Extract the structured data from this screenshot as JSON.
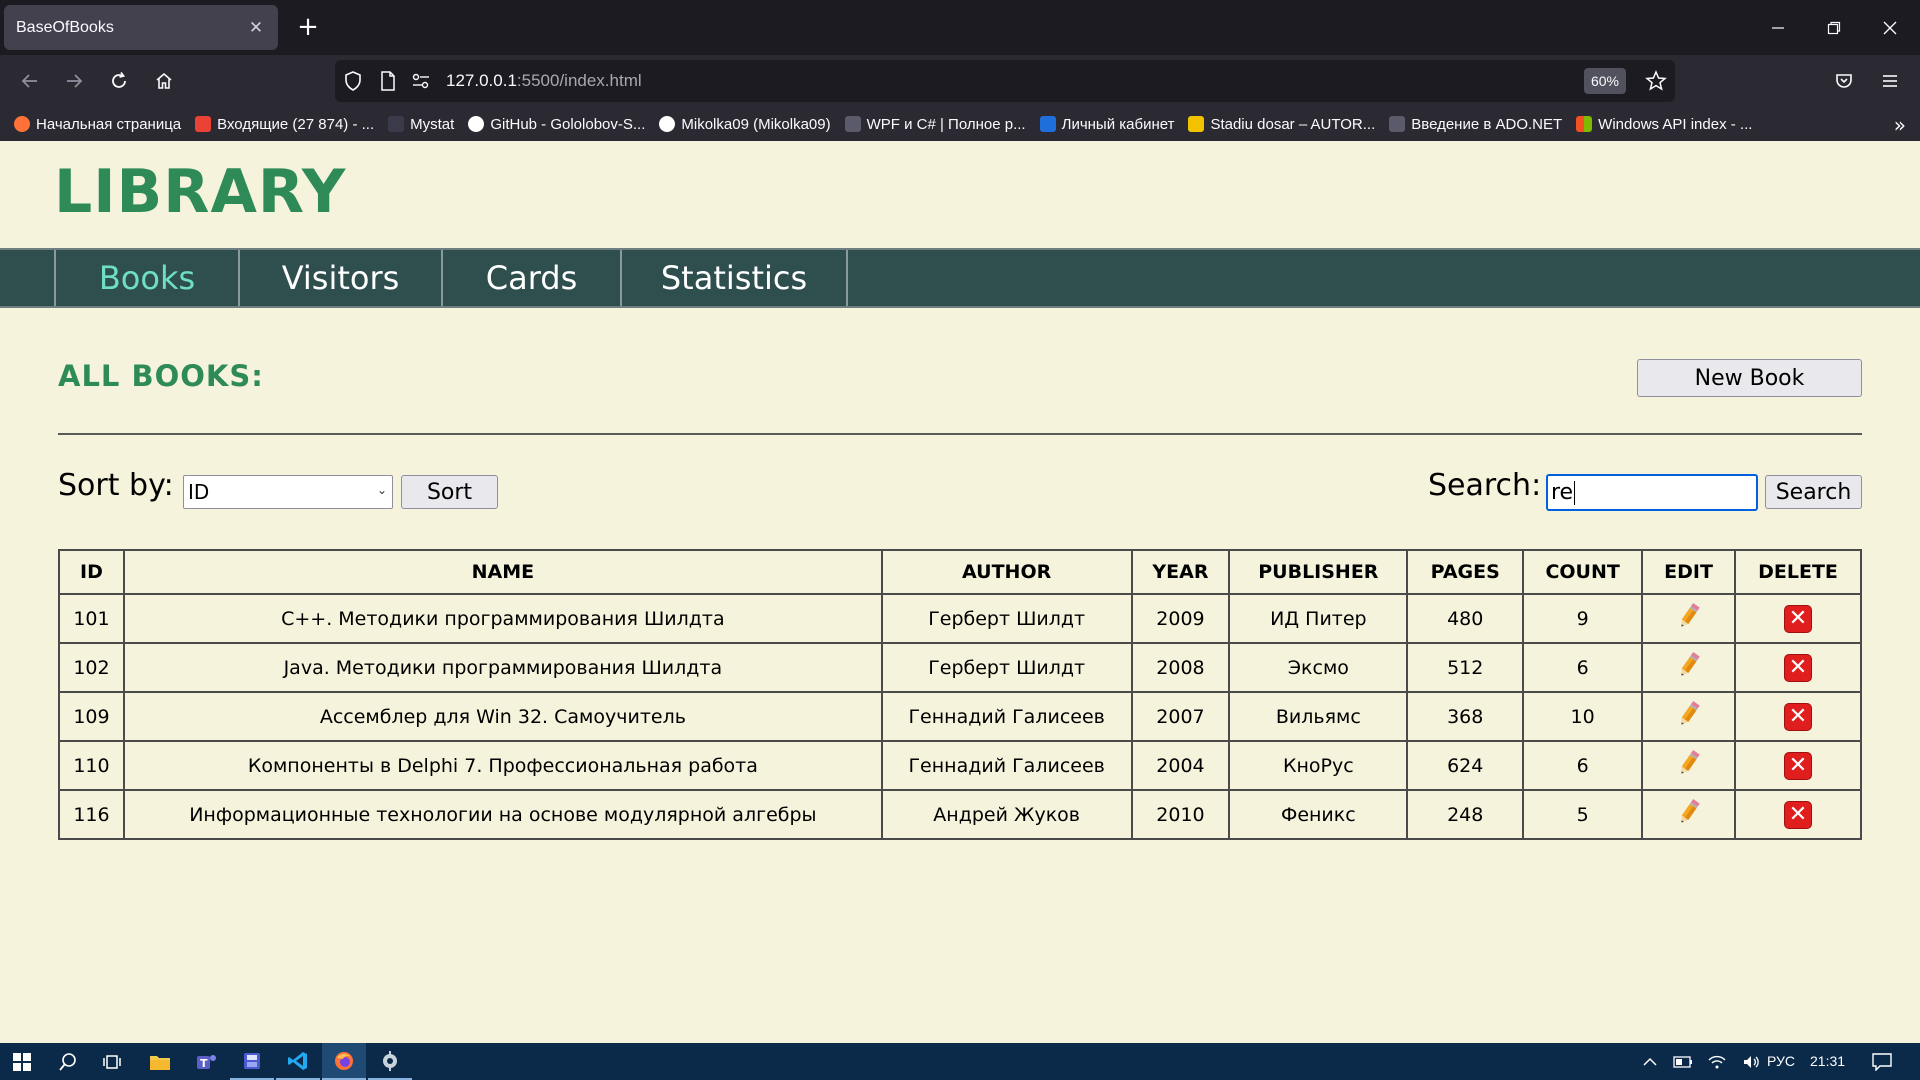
{
  "browser": {
    "tab_title": "BaseOfBooks",
    "tab_close": "✕",
    "new_tab": "+",
    "url_host": "127.0.0.1",
    "url_rest": ":5500/index.html",
    "zoom": "60%",
    "bookmarks": [
      {
        "label": "Начальная страница",
        "color": "#ff7139"
      },
      {
        "label": "Входящие (27 874) - ...",
        "color": "#ea4335"
      },
      {
        "label": "Mystat",
        "color": "#3a3a4a"
      },
      {
        "label": "GitHub - Gololobov-S...",
        "color": "#ffffff"
      },
      {
        "label": "Mikolka09 (Mikolka09)",
        "color": "#ffffff"
      },
      {
        "label": "WPF и C# | Полное р...",
        "color": "#5a5a6a"
      },
      {
        "label": "Личный кабинет",
        "color": "#1e6fd9"
      },
      {
        "label": "Stadiu dosar – AUTOR...",
        "color": "#f2c200"
      },
      {
        "label": "Введение в ADO.NET",
        "color": "#5a5a6a"
      },
      {
        "label": "Windows API index - ...",
        "color": "#00a4ef"
      }
    ],
    "bookmarks_more": "»"
  },
  "page": {
    "logo": "LIBRARY",
    "menu": [
      "Books",
      "Visitors",
      "Cards",
      "Statistics"
    ],
    "active_menu": "Books",
    "section_title": "ALL BOOKS:",
    "new_book_label": "New Book",
    "sort_label": "Sort by:",
    "sort_value": "ID",
    "sort_button": "Sort",
    "search_label": "Search:",
    "search_value": "re",
    "search_button": "Search"
  },
  "table": {
    "headers": [
      "ID",
      "NAME",
      "AUTHOR",
      "YEAR",
      "PUBLISHER",
      "PAGES",
      "COUNT",
      "EDIT",
      "DELETE"
    ],
    "rows": [
      [
        "101",
        "C++. Методики программирования Шилдта",
        "Герберт Шилдт",
        "2009",
        "ИД Питер",
        "480",
        "9"
      ],
      [
        "102",
        "Java. Методики программирования Шилдта",
        "Герберт Шилдт",
        "2008",
        "Эксмо",
        "512",
        "6"
      ],
      [
        "109",
        "Ассемблер для Win 32. Самоучитель",
        "Геннадий Галисеев",
        "2007",
        "Вильямс",
        "368",
        "10"
      ],
      [
        "110",
        "Компоненты в Delphi 7. Профессиональная работа",
        "Геннадий Галисеев",
        "2004",
        "КноРус",
        "624",
        "6"
      ],
      [
        "116",
        "Информационные технологии на основе модулярной алгебры",
        "Андрей Жуков",
        "2010",
        "Феникс",
        "248",
        "5"
      ]
    ]
  },
  "taskbar": {
    "lang": "РУС",
    "time": "21:31"
  }
}
